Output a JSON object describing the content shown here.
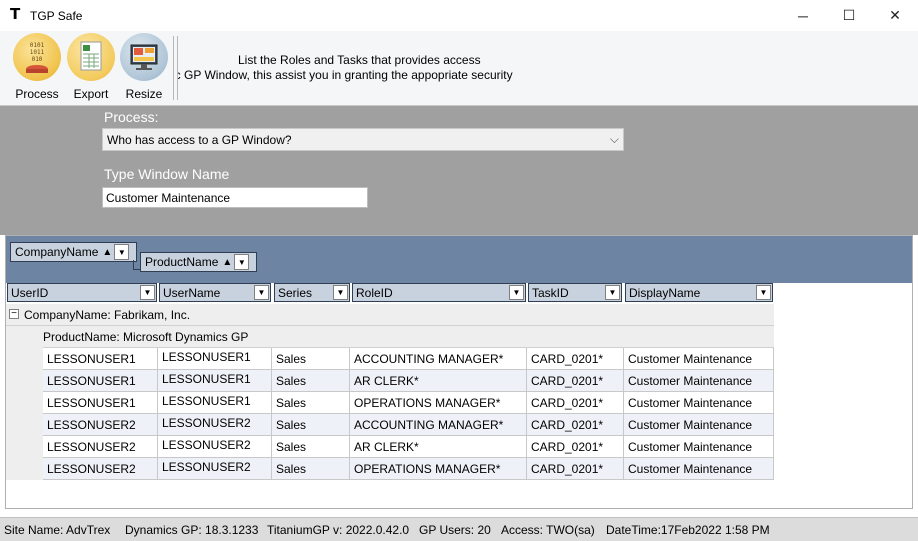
{
  "window": {
    "icon_letter": "T",
    "title": "TGP Safe",
    "minimize": "─",
    "maximize": "☐",
    "close": "✕"
  },
  "ribbon": {
    "buttons": [
      {
        "label": "Process",
        "icon": "process-binary-icon"
      },
      {
        "label": "Export",
        "icon": "excel-export-icon"
      },
      {
        "label": "Resize",
        "icon": "monitor-resize-icon"
      }
    ],
    "description_line1": "List the Roles and Tasks that provides access",
    "description_line2": "ific GP Window, this assist you in granting the appopriate security"
  },
  "form": {
    "process_label": "Process:",
    "process_value": "Who has access to a GP Window?",
    "window_label": "Type Window Name",
    "window_value": "Customer Maintenance"
  },
  "grid": {
    "group_chips": [
      "CompanyName",
      "ProductName"
    ],
    "columns": [
      "UserID",
      "UserName",
      "Series",
      "RoleID",
      "TaskID",
      "DisplayName"
    ],
    "company_group": "CompanyName: Fabrikam, Inc.",
    "product_group": "ProductName: Microsoft Dynamics GP",
    "rows": [
      [
        "LESSONUSER1",
        "LESSONUSER1",
        "Sales",
        "ACCOUNTING MANAGER*",
        "CARD_0201*",
        "Customer Maintenance"
      ],
      [
        "LESSONUSER1",
        "LESSONUSER1",
        "Sales",
        "AR CLERK*",
        "CARD_0201*",
        "Customer Maintenance"
      ],
      [
        "LESSONUSER1",
        "LESSONUSER1",
        "Sales",
        "OPERATIONS MANAGER*",
        "CARD_0201*",
        "Customer Maintenance"
      ],
      [
        "LESSONUSER2",
        "LESSONUSER2",
        "Sales",
        "ACCOUNTING MANAGER*",
        "CARD_0201*",
        "Customer Maintenance"
      ],
      [
        "LESSONUSER2",
        "LESSONUSER2",
        "Sales",
        "AR CLERK*",
        "CARD_0201*",
        "Customer Maintenance"
      ],
      [
        "LESSONUSER2",
        "LESSONUSER2",
        "Sales",
        "OPERATIONS MANAGER*",
        "CARD_0201*",
        "Customer Maintenance"
      ]
    ]
  },
  "status": {
    "site": "Site Name: AdvTrex",
    "gp_version": "Dynamics GP: 18.3.1233",
    "titanium": "TitaniumGP v: 2022.0.42.0",
    "users": "GP Users: 20",
    "access": "Access: TWO(sa)",
    "datetime": "DateTime:17Feb2022 1:58 PM"
  }
}
